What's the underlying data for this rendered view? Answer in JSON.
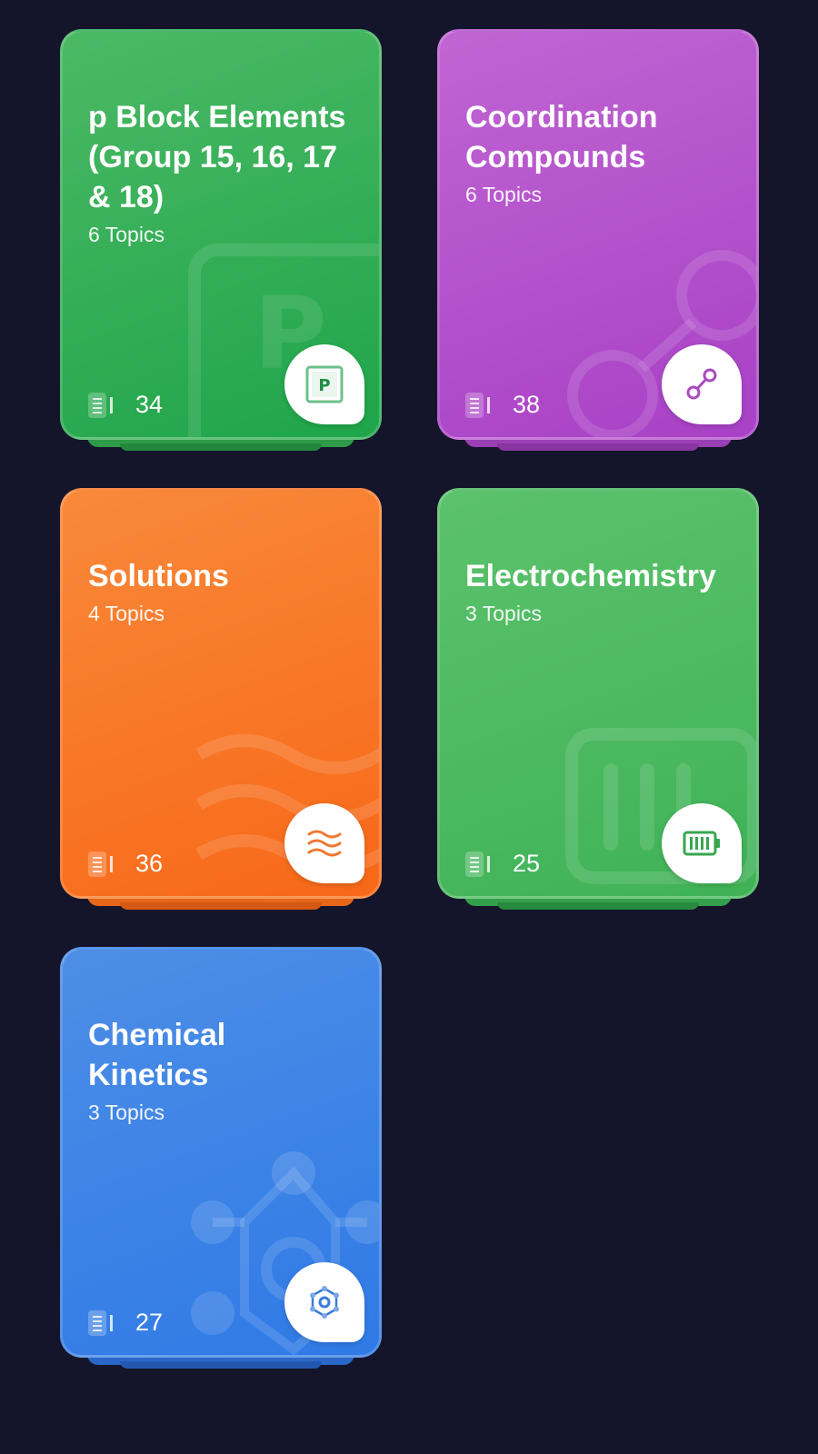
{
  "subjects": [
    {
      "title": "p Block Elements\n(Group 15, 16, 17\n& 18)",
      "topics": "6 Topics",
      "count": "34",
      "icon": "p-block-icon",
      "icon_letter": "P",
      "colors": {
        "from": "#4cb965",
        "to": "#1fa54a",
        "stack": "#2d9b48",
        "icon": "#2ea55a"
      }
    },
    {
      "title": "Coordination\nCompounds",
      "topics": "6 Topics",
      "count": "38",
      "icon": "molecule-link-icon",
      "colors": {
        "from": "#c065d2",
        "to": "#a841c6",
        "stack": "#9b3fb4",
        "icon": "#a94cc0"
      }
    },
    {
      "title": "Solutions",
      "topics": "4 Topics",
      "count": "36",
      "icon": "waves-icon",
      "colors": {
        "from": "#f9893a",
        "to": "#f76818",
        "stack": "#e7661a",
        "icon": "#ef7a32"
      }
    },
    {
      "title": "Electrochemistry",
      "topics": "3 Topics",
      "count": "25",
      "icon": "battery-icon",
      "colors": {
        "from": "#5cc26c",
        "to": "#3fb257",
        "stack": "#33a04c",
        "icon": "#38a64f"
      }
    },
    {
      "title": "Chemical\nKinetics",
      "topics": "3 Topics",
      "count": "27",
      "icon": "gear-molecule-icon",
      "colors": {
        "from": "#4d8ee6",
        "to": "#2f7ae6",
        "stack": "#2a68c8",
        "icon": "#3a7bd8"
      }
    }
  ]
}
